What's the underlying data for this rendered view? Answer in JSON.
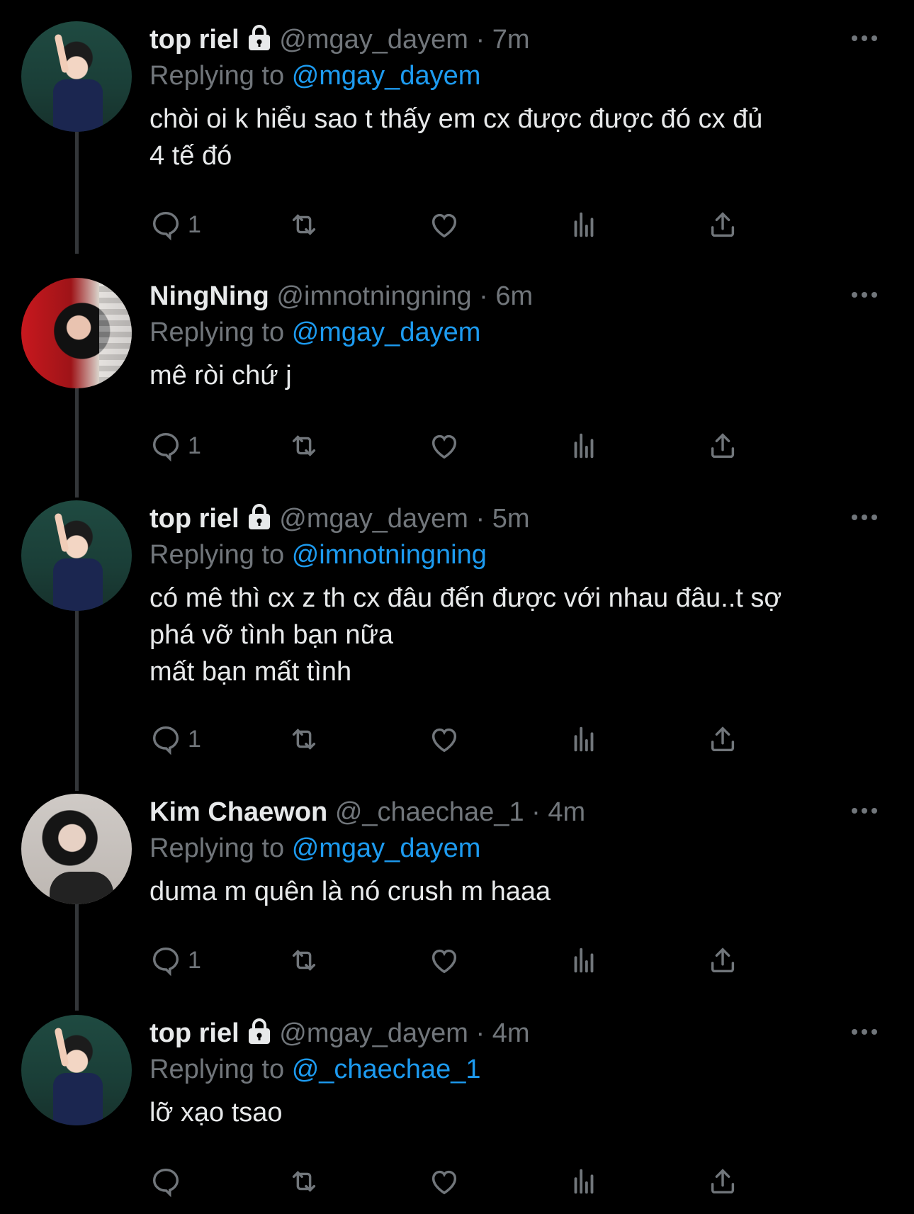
{
  "tweets": [
    {
      "name": "top riel",
      "locked": true,
      "handle": "@mgay_dayem",
      "time": "7m",
      "replying_prefix": "Replying to",
      "replying_to": "@mgay_dayem",
      "text": "chòi oi k hiểu sao t thấy em cx được được đó cx đủ\n4 tế đó",
      "reply_count": "1",
      "avatar": "green"
    },
    {
      "name": "NingNing",
      "locked": false,
      "handle": "@imnotningning",
      "time": "6m",
      "replying_prefix": "Replying to",
      "replying_to": "@mgay_dayem",
      "text": "mê ròi chứ j",
      "reply_count": "1",
      "avatar": "red"
    },
    {
      "name": "top riel",
      "locked": true,
      "handle": "@mgay_dayem",
      "time": "5m",
      "replying_prefix": "Replying to",
      "replying_to": "@imnotningning",
      "text": "có mê thì cx z th cx đâu đến được với nhau đâu..t sợ\nphá vỡ tình bạn nữa\nmất bạn mất tình",
      "reply_count": "1",
      "avatar": "green"
    },
    {
      "name": "Kim Chaewon",
      "locked": false,
      "handle": "@_chaechae_1",
      "time": "4m",
      "replying_prefix": "Replying to",
      "replying_to": "@mgay_dayem",
      "text": "duma m quên là nó crush m haaa",
      "reply_count": "1",
      "avatar": "grey"
    },
    {
      "name": "top riel",
      "locked": true,
      "handle": "@mgay_dayem",
      "time": "4m",
      "replying_prefix": "Replying to",
      "replying_to": "@_chaechae_1",
      "text": "lỡ xạo tsao",
      "reply_count": "",
      "avatar": "green"
    }
  ],
  "separator": "·",
  "icons": {
    "reply": "comment-icon",
    "retweet": "retweet-icon",
    "like": "heart-icon",
    "views": "views-chart-icon",
    "share": "share-icon",
    "more": "more-dots-icon",
    "lock": "lock-icon"
  },
  "colors": {
    "background": "#000000",
    "text": "#e7e9ea",
    "muted": "#71767b",
    "mention": "#1d9bf0",
    "thread_line": "#333639"
  }
}
